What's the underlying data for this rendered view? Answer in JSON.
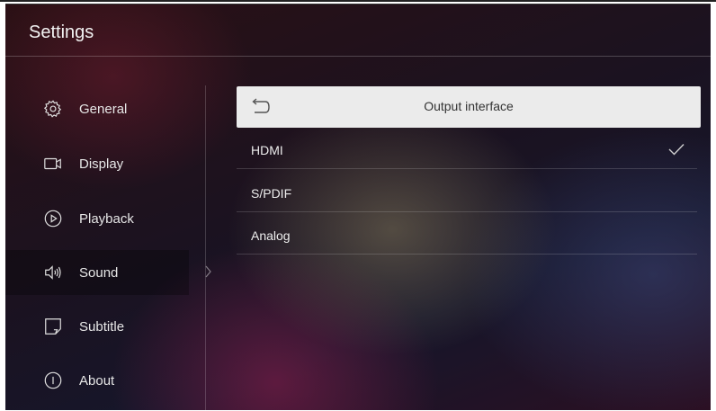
{
  "header": {
    "title": "Settings"
  },
  "sidebar": {
    "items": [
      {
        "label": "General",
        "icon": "gear-icon"
      },
      {
        "label": "Display",
        "icon": "display-icon"
      },
      {
        "label": "Playback",
        "icon": "play-circle-icon"
      },
      {
        "label": "Sound",
        "icon": "speaker-icon",
        "selected": true
      },
      {
        "label": "Subtitle",
        "icon": "subtitle-icon"
      },
      {
        "label": "About",
        "icon": "info-icon"
      }
    ]
  },
  "panel": {
    "title": "Output interface",
    "back_icon": "back-icon",
    "options": [
      {
        "label": "HDMI",
        "checked": true
      },
      {
        "label": "S/PDIF",
        "checked": false
      },
      {
        "label": "Analog",
        "checked": false
      }
    ]
  },
  "colors": {
    "accent_check": "#cfcfcf",
    "panel_header_bg": "#ebebeb"
  }
}
